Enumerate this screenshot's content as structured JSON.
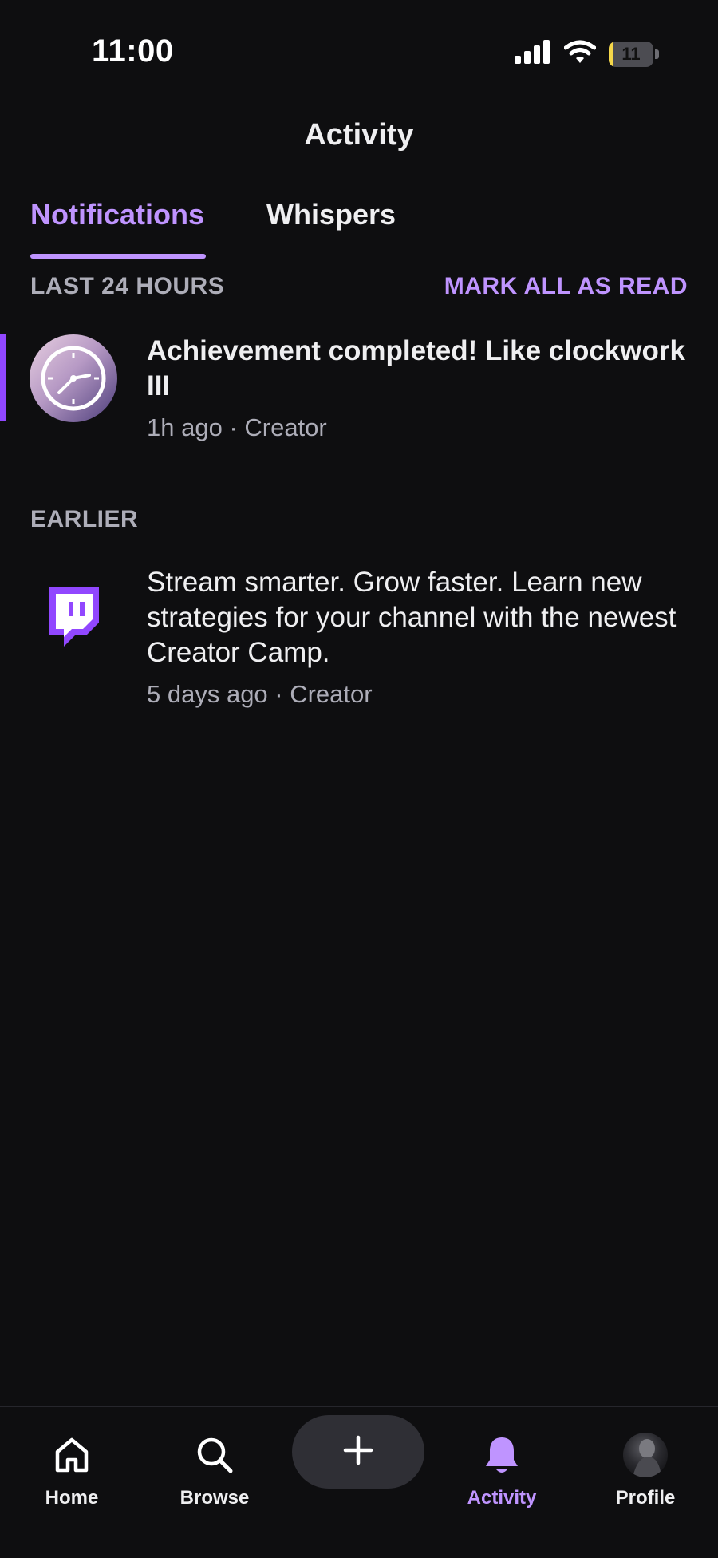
{
  "status_bar": {
    "time": "11:00",
    "battery": "11",
    "battery_level": 0.11
  },
  "header": {
    "title": "Activity"
  },
  "tabs": [
    {
      "label": "Notifications",
      "active": true
    },
    {
      "label": "Whispers",
      "active": false
    }
  ],
  "sections": {
    "recent": {
      "label": "LAST 24 HOURS",
      "action": "MARK ALL AS READ",
      "items": [
        {
          "title": "Achievement completed! Like clockwork III",
          "meta": "1h ago · Creator",
          "icon": "clock-achievement-icon",
          "unread": true
        }
      ]
    },
    "earlier": {
      "label": "EARLIER",
      "items": [
        {
          "title": "Stream smarter. Grow faster. Learn new strategies for your channel with the newest Creator Camp.",
          "meta": "5 days ago · Creator",
          "icon": "twitch-logo-icon",
          "unread": false
        }
      ]
    }
  },
  "bottom_nav": {
    "items": [
      {
        "label": "Home",
        "icon": "home-icon"
      },
      {
        "label": "Browse",
        "icon": "search-icon"
      },
      {
        "label": "Activity",
        "icon": "bell-icon",
        "active": true
      },
      {
        "label": "Profile",
        "icon": "avatar"
      }
    ],
    "create_icon": "plus-icon"
  },
  "colors": {
    "accent": "#bf94ff",
    "brand": "#9147ff",
    "background": "#0e0e10",
    "muted": "#adadb8"
  }
}
